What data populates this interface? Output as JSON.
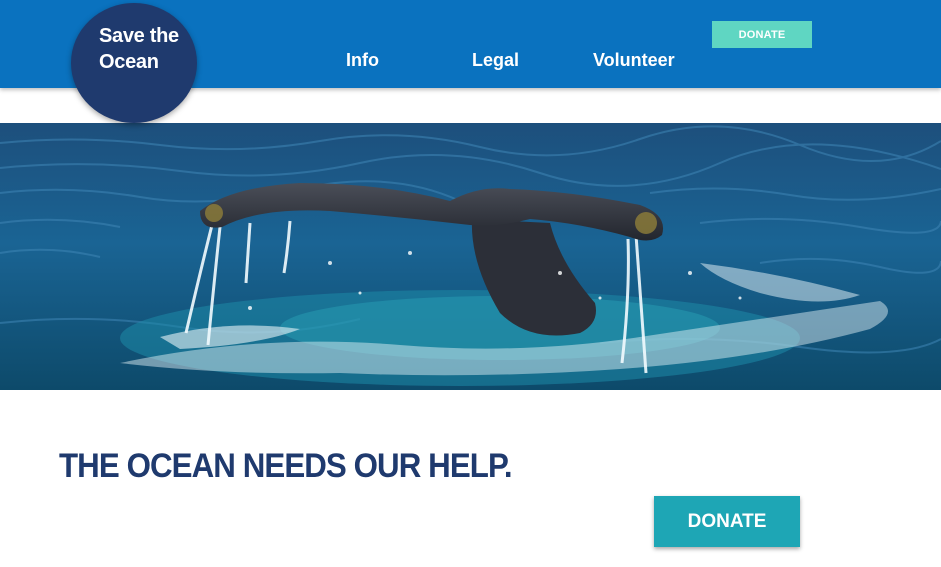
{
  "header": {
    "logo_text": "Save the Ocean",
    "nav": {
      "info": "Info",
      "legal": "Legal",
      "volunteer": "Volunteer"
    },
    "donate_label": "DONATE"
  },
  "hero": {
    "image_subject": "whale-tail-ocean-photo"
  },
  "main": {
    "headline": "THE OCEAN NEEDS OUR HELP.",
    "donate_label": "DONATE"
  },
  "colors": {
    "header_bg": "#0a72bf",
    "logo_bg": "#1f3a6e",
    "donate_top_bg": "#5fd6c2",
    "donate_main_bg": "#1ea6b5",
    "headline": "#1f3a6e"
  }
}
